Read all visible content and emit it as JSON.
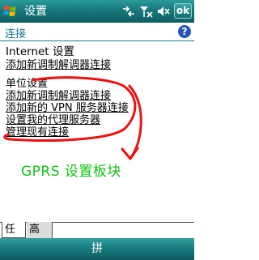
{
  "titlebar": {
    "title": "设置",
    "ok_label": "ok",
    "icons": [
      "windows-start-icon",
      "connectivity-icon",
      "signal-off-icon",
      "volume-muted-icon"
    ]
  },
  "header": {
    "title": "连接",
    "help_label": "?"
  },
  "internet": {
    "title": "Internet 设置",
    "links": [
      "添加新调制解调器连接"
    ]
  },
  "work": {
    "title": "单位设置",
    "links": [
      "添加新调制解调器连接",
      "添加新的 VPN 服务器连接",
      "设置我的代理服务器",
      "管理现有连接"
    ]
  },
  "annotation": {
    "text": "GPRS 设置板块",
    "color": "#13c213",
    "mark_color": "#ee1111"
  },
  "tabs": [
    "任务",
    "高级"
  ],
  "softbar": {
    "keyboard_label": "拼"
  },
  "colors": {
    "titlebar": "#17787b",
    "header_text": "#1c6f8f",
    "help_icon": "#2856b6"
  }
}
